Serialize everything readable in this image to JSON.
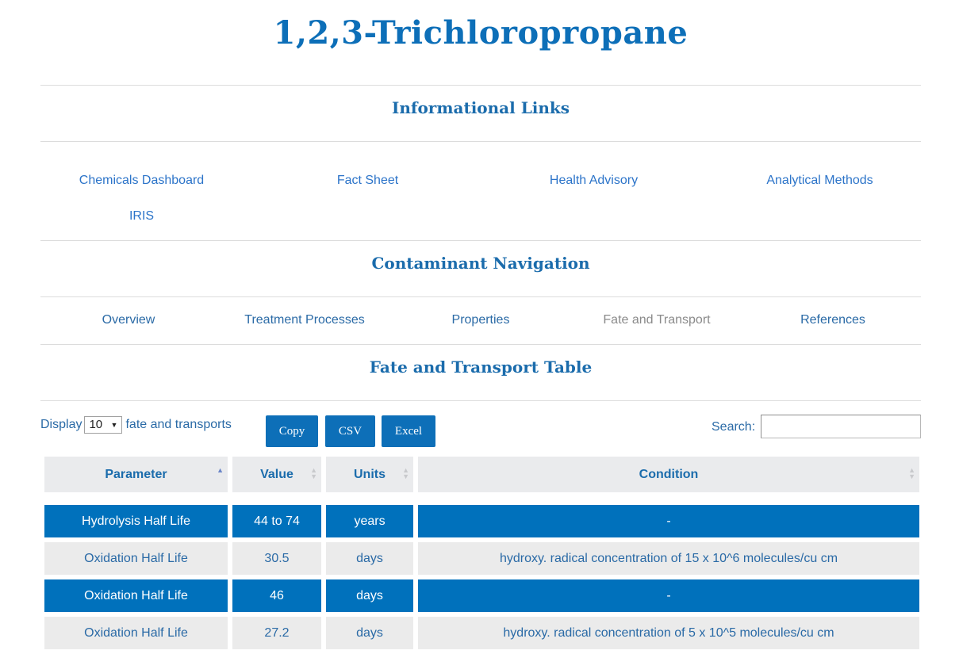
{
  "page": {
    "title": "1,2,3-Trichloropropane"
  },
  "informational_links": {
    "heading": "Informational Links",
    "items": [
      {
        "label": "Chemicals Dashboard"
      },
      {
        "label": "Fact Sheet"
      },
      {
        "label": "Health Advisory"
      },
      {
        "label": "Analytical Methods"
      },
      {
        "label": "IRIS"
      }
    ]
  },
  "contaminant_navigation": {
    "heading": "Contaminant Navigation",
    "items": [
      {
        "label": "Overview",
        "active": false
      },
      {
        "label": "Treatment Processes",
        "active": false
      },
      {
        "label": "Properties",
        "active": false
      },
      {
        "label": "Fate and Transport",
        "active": true
      },
      {
        "label": "References",
        "active": false
      }
    ]
  },
  "table_section": {
    "heading": "Fate and Transport Table",
    "length_menu": {
      "prefix": "Display",
      "selected": "10",
      "suffix": "fate and transports"
    },
    "buttons": {
      "copy": "Copy",
      "csv": "CSV",
      "excel": "Excel"
    },
    "search": {
      "label": "Search:",
      "value": "",
      "placeholder": ""
    },
    "columns": [
      {
        "label": "Parameter",
        "sort": "ascending"
      },
      {
        "label": "Value",
        "sort": "none"
      },
      {
        "label": "Units",
        "sort": "none"
      },
      {
        "label": "Condition",
        "sort": "none"
      }
    ],
    "rows": [
      {
        "parameter": "Hydrolysis Half Life",
        "value": "44 to 74",
        "units": "years",
        "condition": "-",
        "selected": true
      },
      {
        "parameter": "Oxidation Half Life",
        "value": "30.5",
        "units": "days",
        "condition": "hydroxy. radical concentration of 15 x 10^6 molecules/cu cm",
        "selected": false
      },
      {
        "parameter": "Oxidation Half Life",
        "value": "46",
        "units": "days",
        "condition": "-",
        "selected": true
      },
      {
        "parameter": "Oxidation Half Life",
        "value": "27.2",
        "units": "days",
        "condition": "hydroxy. radical concentration of 5 x 10^5 molecules/cu cm",
        "selected": false
      }
    ]
  },
  "colors": {
    "brand_blue": "#0d6fb8",
    "selected_row": "#0071bc",
    "header_bg": "#eaebed",
    "row_bg": "#ebebeb",
    "active_nav": "#8a8a8a"
  }
}
